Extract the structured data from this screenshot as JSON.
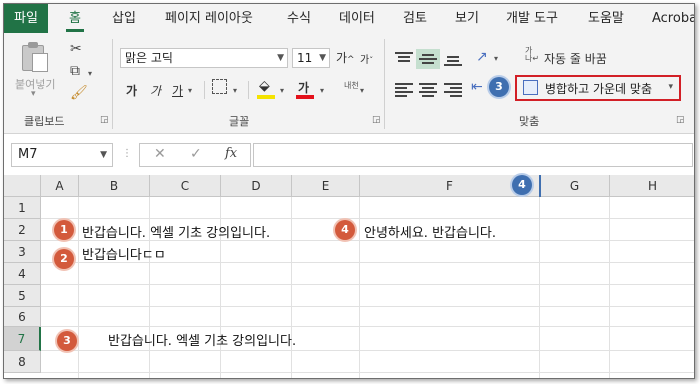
{
  "tabs": {
    "file": "파일",
    "home": "홈",
    "insert": "삽입",
    "layout": "페이지 레이아웃",
    "formulas": "수식",
    "data": "데이터",
    "review": "검토",
    "view": "보기",
    "developer": "개발 도구",
    "help": "도움말",
    "acrobat": "Acrobat"
  },
  "ribbon": {
    "clipboard": {
      "paste_label": "붙여넣기",
      "group_label": "클립보드"
    },
    "font": {
      "font_name": "맑은 고딕",
      "font_size": "11",
      "grow_font": "가",
      "shrink_font": "가",
      "bold": "가",
      "italic": "가",
      "underline": "가",
      "font_color_glyph": "가",
      "phonetic_label": "내천",
      "group_label": "글꼴"
    },
    "alignment": {
      "wrap_text": "자동 줄 바꿈",
      "merge_center": "병합하고 가운데 맞춤",
      "group_label": "맞춤"
    },
    "accent_color": "#217346",
    "highlight_color": "#d21f26"
  },
  "formula_bar": {
    "name_box": "M7",
    "cancel_symbol": "✕",
    "enter_symbol": "✓",
    "fx_symbol": "fx",
    "formula": ""
  },
  "grid": {
    "columns": [
      "A",
      "B",
      "C",
      "D",
      "E",
      "F",
      "G",
      "H"
    ],
    "rows": [
      "1",
      "2",
      "3",
      "4",
      "5",
      "6",
      "7",
      "8"
    ],
    "selected_row": "7",
    "cells": {
      "b2": "반갑습니다. 엑셀 기초 강의입니다.",
      "f2": "안녕하세요. 반갑습니다.",
      "b3": "반갑습니다ㄷㅁ",
      "b7": "반갑습니다. 엑셀 기초 강의입니다."
    }
  },
  "callouts": {
    "one": "1",
    "two": "2",
    "three_ribbon": "3",
    "three_row": "3",
    "four_header": "4",
    "four_row": "4"
  }
}
